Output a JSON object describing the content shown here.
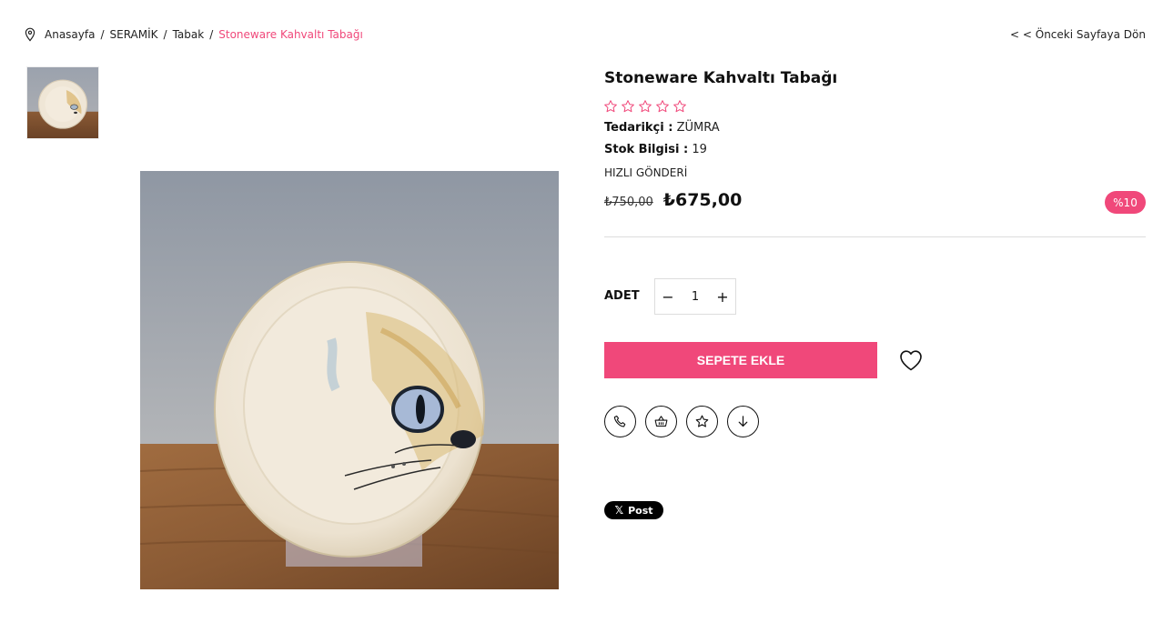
{
  "breadcrumb": {
    "items": [
      "Anasayfa",
      "SERAMİK",
      "Tabak"
    ],
    "separator": "/",
    "current": "Stoneware Kahvaltı Tabağı"
  },
  "back_link": "< < Önceki Sayfaya Dön",
  "product": {
    "title": "Stoneware Kahvaltı Tabağı",
    "rating": {
      "filled": 0,
      "max": 5
    },
    "supplier_label": "Tedarikçi :",
    "supplier_value": "ZÜMRA",
    "stock_label": "Stok Bilgisi :",
    "stock_value": "19",
    "shipping": "HIZLI GÖNDERİ",
    "old_price": "₺750,00",
    "new_price": "₺675,00",
    "discount": "%10"
  },
  "quantity": {
    "label": "ADET",
    "value": "1",
    "minus": "−",
    "plus": "+"
  },
  "add_to_cart": "SEPETE EKLE",
  "action_icons": [
    "phone-icon",
    "basket-icon",
    "star-icon",
    "download-icon"
  ],
  "social": {
    "x_logo": "𝕏",
    "post_label": "Post"
  },
  "colors": {
    "accent": "#f0487a",
    "text": "#111111",
    "divider": "#dddddd"
  }
}
